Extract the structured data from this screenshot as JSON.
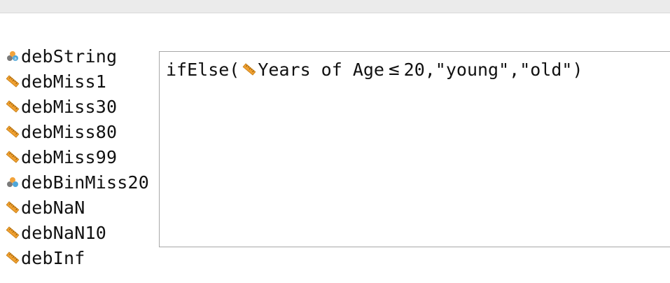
{
  "variables": [
    {
      "label": "debString",
      "icon": "nominal-string-icon"
    },
    {
      "label": "debMiss1",
      "icon": "scale-ruler-icon"
    },
    {
      "label": "debMiss30",
      "icon": "scale-ruler-icon"
    },
    {
      "label": "debMiss80",
      "icon": "scale-ruler-icon"
    },
    {
      "label": "debMiss99",
      "icon": "scale-ruler-icon"
    },
    {
      "label": "debBinMiss20",
      "icon": "nominal-icon"
    },
    {
      "label": "debNaN",
      "icon": "scale-ruler-icon"
    },
    {
      "label": "debNaN10",
      "icon": "scale-ruler-icon"
    },
    {
      "label": "debInf",
      "icon": "scale-ruler-icon"
    }
  ],
  "editor": {
    "func_name": "ifElse(",
    "var_name": "Years of Age",
    "operator": "≤",
    "rest": "20,\"young\",\"old\")"
  },
  "colors": {
    "ruler": "#f0a030",
    "nominal_gray": "#7a7a7a",
    "nominal_orange": "#f2a33a",
    "nominal_blue": "#4fa7d9"
  }
}
